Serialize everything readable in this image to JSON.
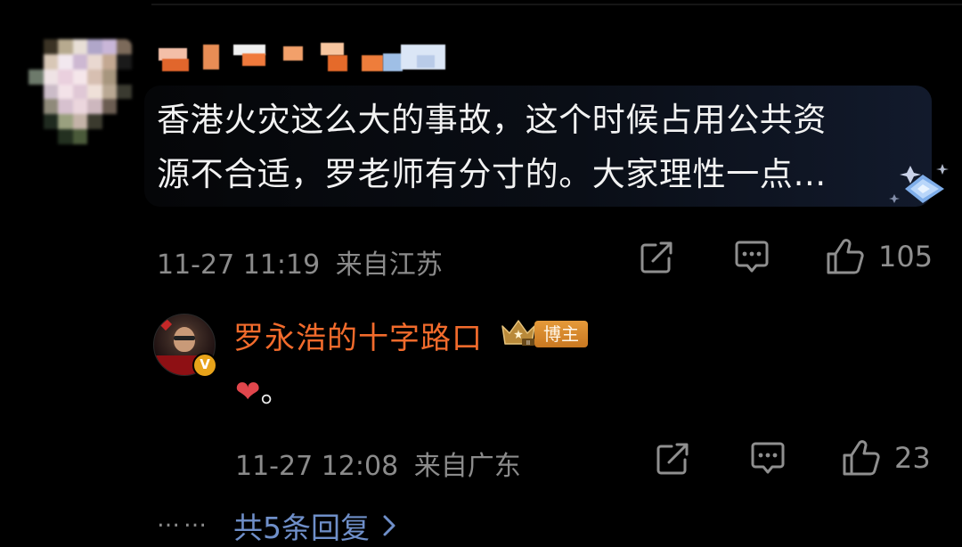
{
  "comment": {
    "text_lines": [
      "香港火灾这么大的事故，这个时候占用公共资",
      "源不合适，罗老师有分寸的。大家理性一点…"
    ],
    "time": "11-27 11:19",
    "location": "来自江苏",
    "likes": "105",
    "icons": [
      "share-icon",
      "comment-icon",
      "like-icon",
      "diamond-badge-icon"
    ]
  },
  "reply": {
    "author": "罗永浩的十字路口",
    "tag": "博主",
    "verified_mark": "V",
    "content": "。",
    "time": "11-27 12:08",
    "location": "来自广东",
    "likes": "23",
    "icons": [
      "heart-emoji",
      "crown-icon",
      "share-icon",
      "comment-icon",
      "like-icon"
    ]
  },
  "more": {
    "dots": "……",
    "label": "共5条回复",
    "chevron": "›"
  },
  "colors": {
    "background": "#000000",
    "author": "#f26b2c",
    "link": "#6f8fc9",
    "meta": "#8b8b8b",
    "heart": "#e1464c"
  }
}
